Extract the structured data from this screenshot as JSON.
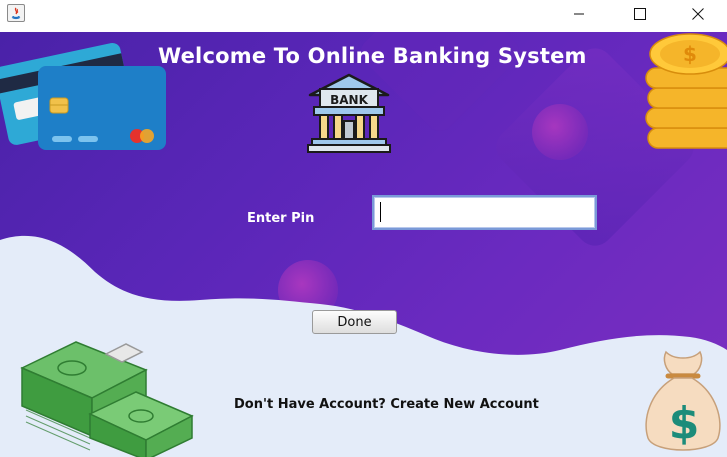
{
  "window": {
    "icon": "java-icon",
    "controls": {
      "minimize": "minimize-icon",
      "maximize": "maximize-icon",
      "close": "close-icon"
    }
  },
  "main": {
    "title": "Welcome To Online Banking System",
    "bank_sign": "BANK",
    "pin_label": "Enter Pin",
    "pin_value": "",
    "done_label": "Done",
    "create_account_text": "Don't Have Account? Create New Account",
    "money_symbol": "$"
  },
  "colors": {
    "background": "#5a26b8",
    "wave": "#e4ecf9",
    "text_light": "#ffffff",
    "text_dark": "#111111"
  }
}
